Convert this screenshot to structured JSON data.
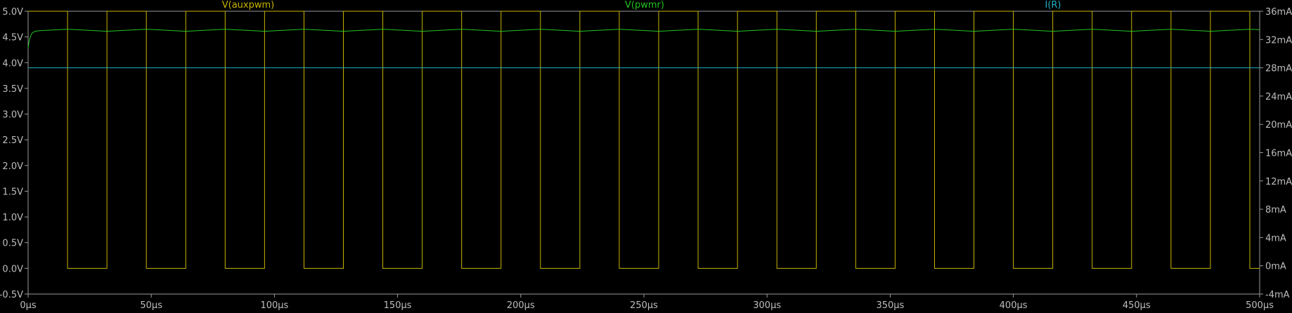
{
  "chart_data": {
    "type": "line",
    "background": "#000000",
    "grid": false,
    "x_ticks": [
      "0µs",
      "50µs",
      "100µs",
      "150µs",
      "200µs",
      "250µs",
      "300µs",
      "350µs",
      "400µs",
      "450µs",
      "500µs"
    ],
    "x_tick_values_us": [
      0,
      50,
      100,
      150,
      200,
      250,
      300,
      350,
      400,
      450,
      500
    ],
    "xlim_us": [
      0,
      500
    ],
    "y_left_ticks": [
      "5.0V",
      "4.5V",
      "4.0V",
      "3.5V",
      "3.0V",
      "2.5V",
      "2.0V",
      "1.5V",
      "1.0V",
      "0.5V",
      "0.0V",
      "-0.5V"
    ],
    "y_left_tick_values": [
      5.0,
      4.5,
      4.0,
      3.5,
      3.0,
      2.5,
      2.0,
      1.5,
      1.0,
      0.5,
      0.0,
      -0.5
    ],
    "ylim_left_V": [
      -0.5,
      5.0
    ],
    "y_right_ticks": [
      "36mA",
      "32mA",
      "28mA",
      "24mA",
      "20mA",
      "16mA",
      "12mA",
      "8mA",
      "4mA",
      "0mA",
      "-4mA"
    ],
    "y_right_tick_values": [
      36,
      32,
      28,
      24,
      20,
      16,
      12,
      8,
      4,
      0,
      -4
    ],
    "ylim_right_mA": [
      -4,
      36
    ],
    "series": [
      {
        "name": "V(auxpwm)",
        "color": "#c8b400",
        "axis": "left",
        "kind": "square_wave",
        "high_V": 5.0,
        "low_V": 0.0,
        "period_us": 32.0,
        "first_fall_us": 16.0,
        "low_duration_us": 16.0
      },
      {
        "name": "V(pwmr)",
        "color": "#22c322",
        "axis": "left",
        "kind": "rc_filtered",
        "start_V": 4.3,
        "settle_tau_us": 0.8,
        "mean_V": 4.63,
        "ripple_V": 0.02
      },
      {
        "name": "I(R)",
        "color": "#20b0c0",
        "axis": "right",
        "kind": "constant",
        "value_mA": 28.0
      }
    ]
  }
}
